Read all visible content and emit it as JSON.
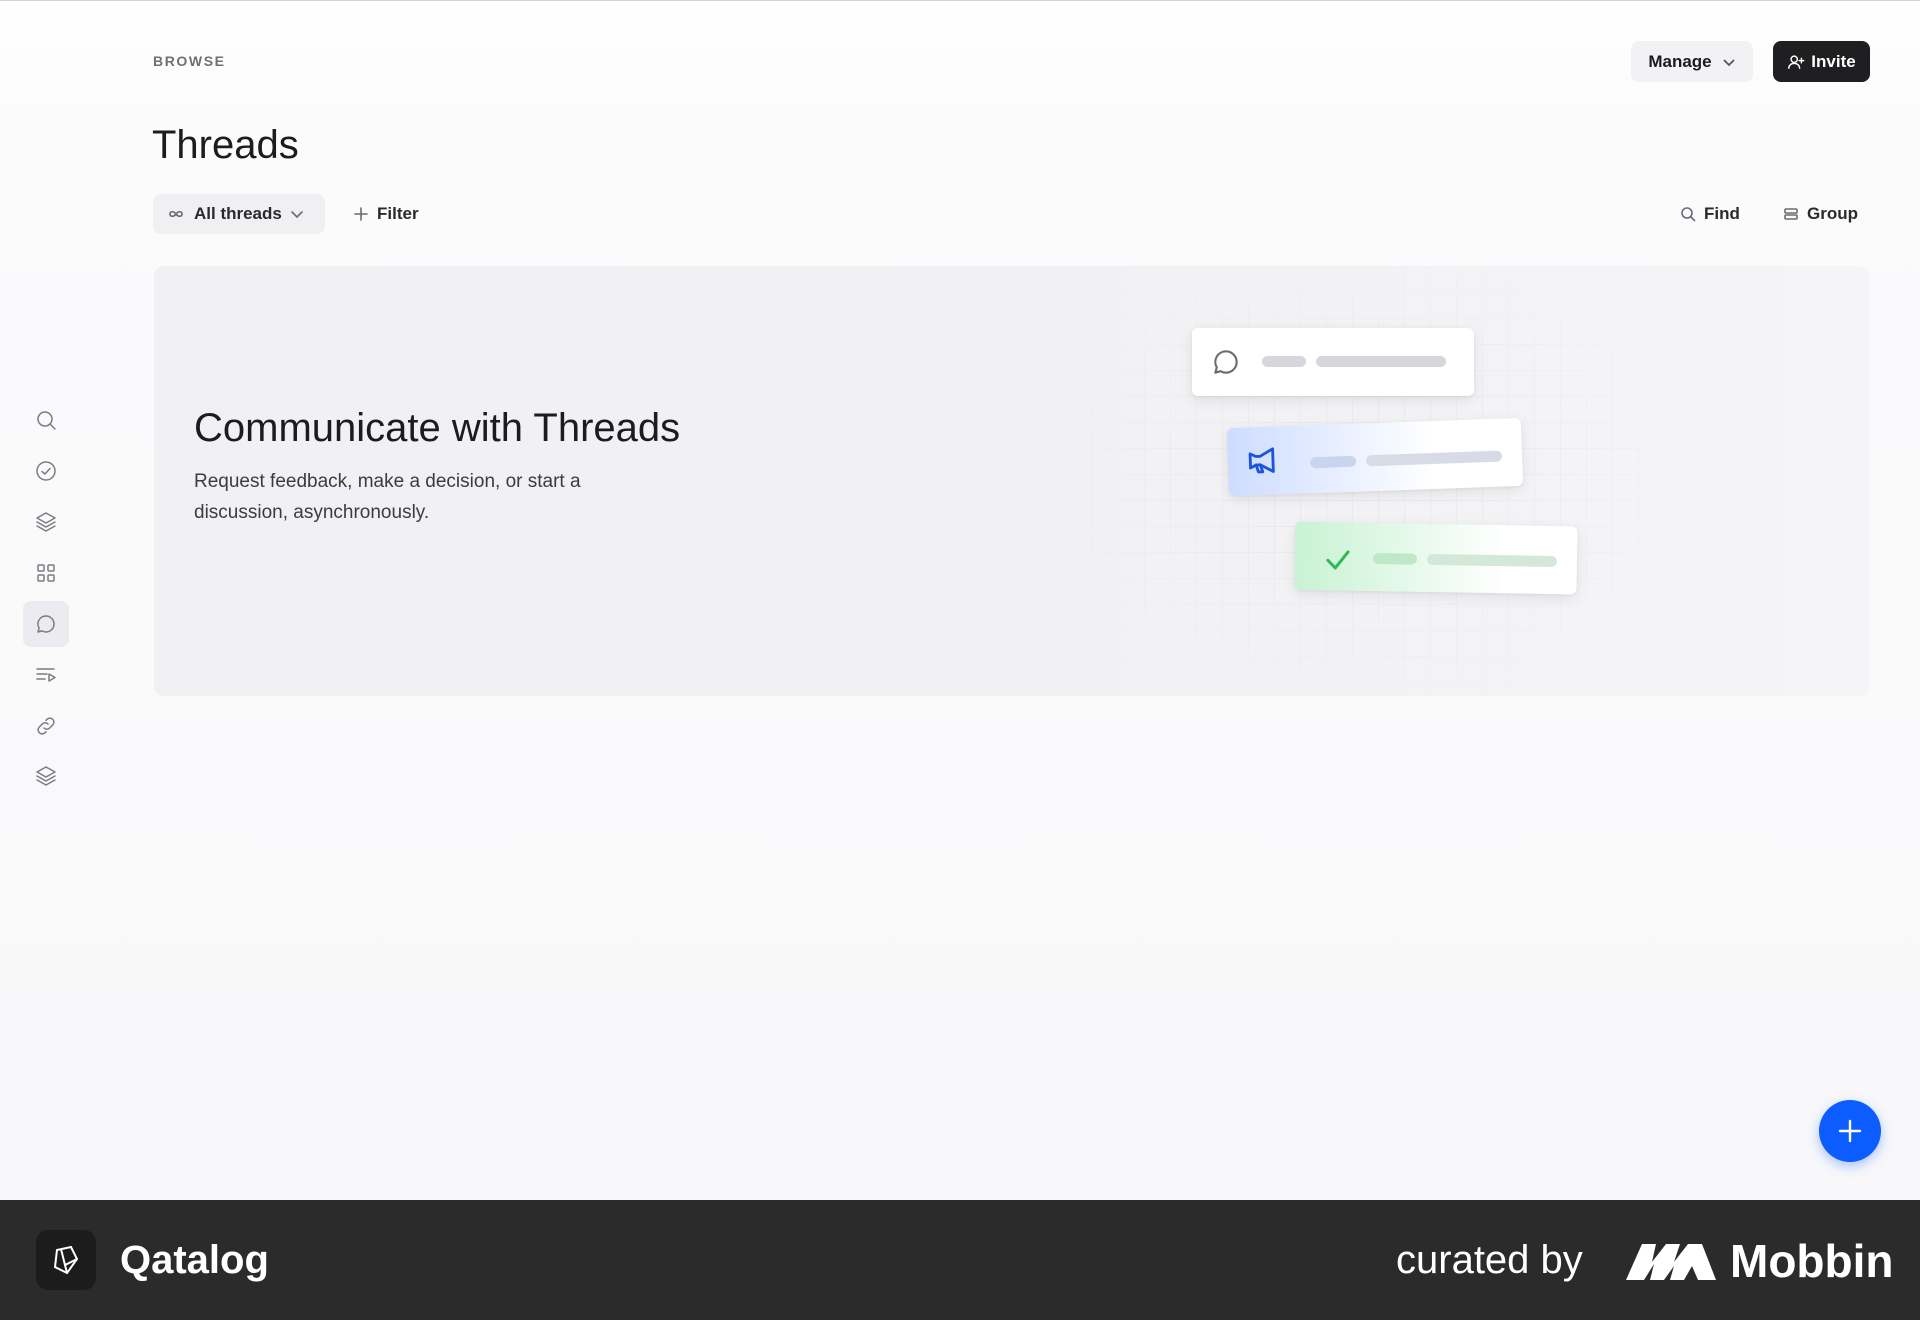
{
  "header": {
    "eyebrow": "BROWSE",
    "title": "Threads",
    "manage_label": "Manage",
    "invite_label": "Invite"
  },
  "sidebar": {
    "items": [
      {
        "icon": "search-icon"
      },
      {
        "icon": "check-circle-icon"
      },
      {
        "icon": "layers-icon"
      },
      {
        "icon": "grid-icon"
      },
      {
        "icon": "chat-bubble-icon",
        "active": true
      },
      {
        "icon": "list-play-icon"
      },
      {
        "icon": "link-icon"
      },
      {
        "icon": "layers-icon"
      }
    ]
  },
  "toolbar": {
    "view_label": "All threads",
    "filter_label": "Filter",
    "find_label": "Find",
    "group_label": "Group"
  },
  "banner": {
    "title": "Communicate with Threads",
    "description": "Request feedback, make a decision, or start a discussion, asynchronously.",
    "cards": [
      {
        "icon": "chat-bubble-icon",
        "accent": "#ffffff"
      },
      {
        "icon": "megaphone-icon",
        "accent": "#cddcff"
      },
      {
        "icon": "check-icon",
        "accent": "#c8f2d3"
      }
    ]
  },
  "fab": {
    "icon": "plus-icon",
    "color": "#0d5cff"
  },
  "footer": {
    "brand": "Qatalog",
    "curated_label": "curated by",
    "curator": "Mobbin"
  },
  "colors": {
    "accent": "#0d5cff",
    "invite_bg": "#1f1f21",
    "footer_bg": "#2b2b2c"
  }
}
